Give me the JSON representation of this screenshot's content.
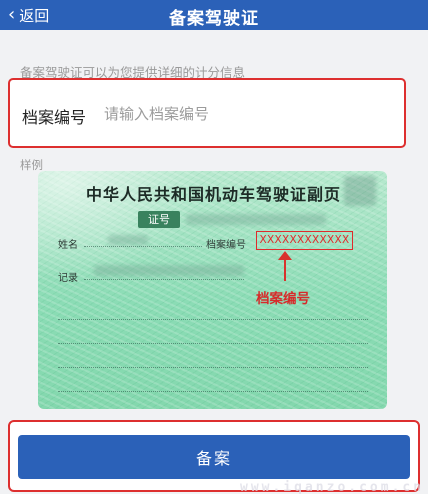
{
  "header": {
    "back_label": "返回",
    "title": "备案驾驶证"
  },
  "info_text": "备案驾驶证可以为您提供详细的计分信息",
  "form": {
    "field_label": "档案编号",
    "field_placeholder": "请输入档案编号",
    "field_value": ""
  },
  "sample": {
    "label": "样例",
    "card_title": "中华人民共和国机动车驾驶证副页",
    "zhenghao_label": "证号",
    "name_label": "姓名",
    "archive_label": "档案编号",
    "archive_value": "XXXXXXXXXXXX",
    "record_label": "记录",
    "annotation": "档案编号"
  },
  "submit_label": "备案",
  "watermark": "www.iqanzo.com.cn",
  "colors": {
    "primary": "#2b61b8",
    "highlight_red": "#dd2f2f",
    "card_green": "#8bdcb5"
  }
}
